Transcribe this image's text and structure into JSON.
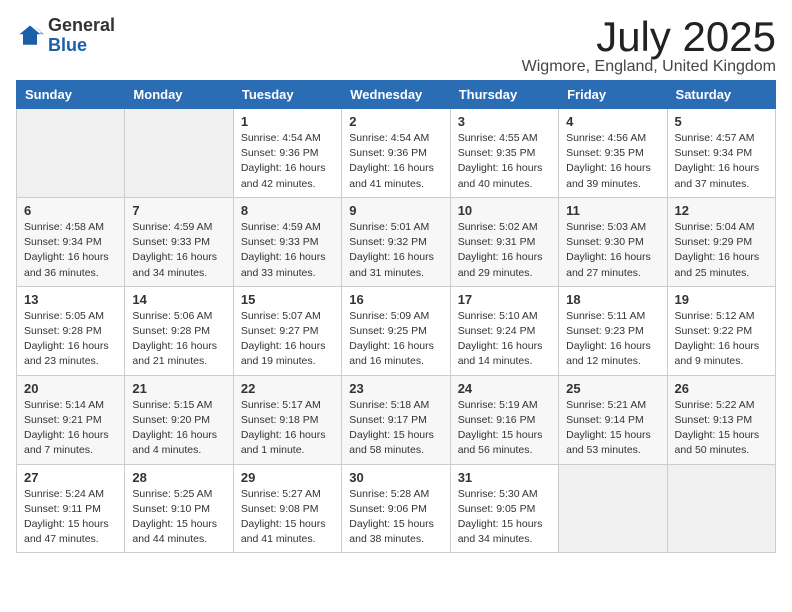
{
  "logo": {
    "general": "General",
    "blue": "Blue"
  },
  "title": "July 2025",
  "location": "Wigmore, England, United Kingdom",
  "days_of_week": [
    "Sunday",
    "Monday",
    "Tuesday",
    "Wednesday",
    "Thursday",
    "Friday",
    "Saturday"
  ],
  "weeks": [
    [
      {
        "day": "",
        "info": ""
      },
      {
        "day": "",
        "info": ""
      },
      {
        "day": "1",
        "info": "Sunrise: 4:54 AM\nSunset: 9:36 PM\nDaylight: 16 hours and 42 minutes."
      },
      {
        "day": "2",
        "info": "Sunrise: 4:54 AM\nSunset: 9:36 PM\nDaylight: 16 hours and 41 minutes."
      },
      {
        "day": "3",
        "info": "Sunrise: 4:55 AM\nSunset: 9:35 PM\nDaylight: 16 hours and 40 minutes."
      },
      {
        "day": "4",
        "info": "Sunrise: 4:56 AM\nSunset: 9:35 PM\nDaylight: 16 hours and 39 minutes."
      },
      {
        "day": "5",
        "info": "Sunrise: 4:57 AM\nSunset: 9:34 PM\nDaylight: 16 hours and 37 minutes."
      }
    ],
    [
      {
        "day": "6",
        "info": "Sunrise: 4:58 AM\nSunset: 9:34 PM\nDaylight: 16 hours and 36 minutes."
      },
      {
        "day": "7",
        "info": "Sunrise: 4:59 AM\nSunset: 9:33 PM\nDaylight: 16 hours and 34 minutes."
      },
      {
        "day": "8",
        "info": "Sunrise: 4:59 AM\nSunset: 9:33 PM\nDaylight: 16 hours and 33 minutes."
      },
      {
        "day": "9",
        "info": "Sunrise: 5:01 AM\nSunset: 9:32 PM\nDaylight: 16 hours and 31 minutes."
      },
      {
        "day": "10",
        "info": "Sunrise: 5:02 AM\nSunset: 9:31 PM\nDaylight: 16 hours and 29 minutes."
      },
      {
        "day": "11",
        "info": "Sunrise: 5:03 AM\nSunset: 9:30 PM\nDaylight: 16 hours and 27 minutes."
      },
      {
        "day": "12",
        "info": "Sunrise: 5:04 AM\nSunset: 9:29 PM\nDaylight: 16 hours and 25 minutes."
      }
    ],
    [
      {
        "day": "13",
        "info": "Sunrise: 5:05 AM\nSunset: 9:28 PM\nDaylight: 16 hours and 23 minutes."
      },
      {
        "day": "14",
        "info": "Sunrise: 5:06 AM\nSunset: 9:28 PM\nDaylight: 16 hours and 21 minutes."
      },
      {
        "day": "15",
        "info": "Sunrise: 5:07 AM\nSunset: 9:27 PM\nDaylight: 16 hours and 19 minutes."
      },
      {
        "day": "16",
        "info": "Sunrise: 5:09 AM\nSunset: 9:25 PM\nDaylight: 16 hours and 16 minutes."
      },
      {
        "day": "17",
        "info": "Sunrise: 5:10 AM\nSunset: 9:24 PM\nDaylight: 16 hours and 14 minutes."
      },
      {
        "day": "18",
        "info": "Sunrise: 5:11 AM\nSunset: 9:23 PM\nDaylight: 16 hours and 12 minutes."
      },
      {
        "day": "19",
        "info": "Sunrise: 5:12 AM\nSunset: 9:22 PM\nDaylight: 16 hours and 9 minutes."
      }
    ],
    [
      {
        "day": "20",
        "info": "Sunrise: 5:14 AM\nSunset: 9:21 PM\nDaylight: 16 hours and 7 minutes."
      },
      {
        "day": "21",
        "info": "Sunrise: 5:15 AM\nSunset: 9:20 PM\nDaylight: 16 hours and 4 minutes."
      },
      {
        "day": "22",
        "info": "Sunrise: 5:17 AM\nSunset: 9:18 PM\nDaylight: 16 hours and 1 minute."
      },
      {
        "day": "23",
        "info": "Sunrise: 5:18 AM\nSunset: 9:17 PM\nDaylight: 15 hours and 58 minutes."
      },
      {
        "day": "24",
        "info": "Sunrise: 5:19 AM\nSunset: 9:16 PM\nDaylight: 15 hours and 56 minutes."
      },
      {
        "day": "25",
        "info": "Sunrise: 5:21 AM\nSunset: 9:14 PM\nDaylight: 15 hours and 53 minutes."
      },
      {
        "day": "26",
        "info": "Sunrise: 5:22 AM\nSunset: 9:13 PM\nDaylight: 15 hours and 50 minutes."
      }
    ],
    [
      {
        "day": "27",
        "info": "Sunrise: 5:24 AM\nSunset: 9:11 PM\nDaylight: 15 hours and 47 minutes."
      },
      {
        "day": "28",
        "info": "Sunrise: 5:25 AM\nSunset: 9:10 PM\nDaylight: 15 hours and 44 minutes."
      },
      {
        "day": "29",
        "info": "Sunrise: 5:27 AM\nSunset: 9:08 PM\nDaylight: 15 hours and 41 minutes."
      },
      {
        "day": "30",
        "info": "Sunrise: 5:28 AM\nSunset: 9:06 PM\nDaylight: 15 hours and 38 minutes."
      },
      {
        "day": "31",
        "info": "Sunrise: 5:30 AM\nSunset: 9:05 PM\nDaylight: 15 hours and 34 minutes."
      },
      {
        "day": "",
        "info": ""
      },
      {
        "day": "",
        "info": ""
      }
    ]
  ]
}
